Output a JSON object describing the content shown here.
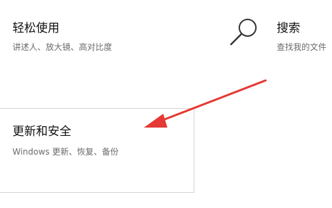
{
  "settings": {
    "ease_of_access": {
      "title": "轻松使用",
      "description": "讲述人、放大镜、高对比度"
    },
    "search": {
      "title": "搜索",
      "description": "查找我的文件"
    },
    "update_security": {
      "title": "更新和安全",
      "description": "Windows 更新、恢复、备份"
    }
  },
  "icons": {
    "search": "search-icon"
  },
  "colors": {
    "arrow": "#e53935",
    "card_border": "#d4d4d4",
    "description_text": "#6b6b6b"
  }
}
